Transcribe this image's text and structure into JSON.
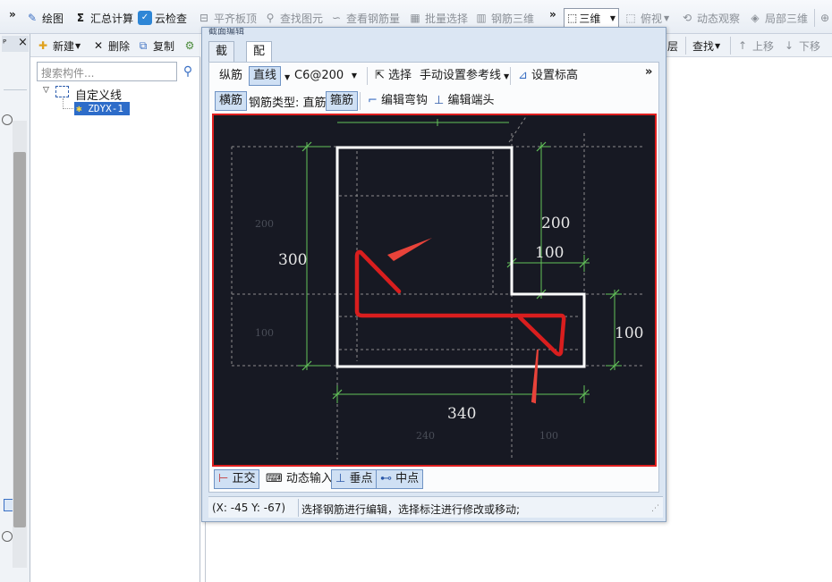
{
  "toolbar": {
    "overflow": "»",
    "draw": "绘图",
    "calc": "汇总计算",
    "cloud_check": "云检查",
    "align_slab": "平齐板顶",
    "find_element": "查找图元",
    "view_rebar": "查看钢筋量",
    "batch_select": "批量选择",
    "rebar_3d": "钢筋三维",
    "overflow2": "»",
    "view_3d": "三维",
    "top_view": "俯视",
    "dynamic_view": "动态观察",
    "local_3d": "局部三维"
  },
  "left_strip": {
    "pin": "ᴾ",
    "close": "×"
  },
  "component_panel": {
    "new": "新建",
    "delete": "删除",
    "copy": "复制",
    "search_placeholder": "搜索构件...",
    "tree_root": "自定义线",
    "tree_child": "ZDYX-1"
  },
  "right_toolbar": {
    "layer": "层",
    "find": "查找",
    "move_up": "上移",
    "move_down": "下移"
  },
  "dialog": {
    "title": "截面编辑",
    "tabs": [
      "截面",
      "配筋"
    ],
    "active_tab": "配筋",
    "row1": {
      "longitudinal": "纵筋",
      "mode": "直线",
      "spec": "C6@200",
      "select": "选择",
      "manual_ref": "手动设置参考线",
      "set_elevation": "设置标高",
      "overflow": "»"
    },
    "row2": {
      "transverse": "横筋",
      "type_label": "钢筋类型:",
      "type_value": "直筋",
      "stirrup": "箍筋",
      "edit_hook": "编辑弯钩",
      "edit_end": "编辑端头"
    },
    "snap": {
      "ortho": "正交",
      "dynamic_input": "动态输入",
      "perpendicular": "垂点",
      "midpoint": "中点"
    },
    "status": {
      "coord": "(X: -45 Y: -67)",
      "message": "选择钢筋进行编辑，选择标注进行修改或移动;"
    }
  },
  "drawing": {
    "dims": {
      "height_total": "300",
      "upper_right": "200",
      "step_width": "100",
      "step_height": "100",
      "bottom_width": "340",
      "faint_left_top": "200",
      "faint_left_bottom": "100",
      "faint_bottom_left": "240",
      "faint_bottom_right": "100"
    },
    "colors": {
      "background": "#171923",
      "section_outline": "#ffffff",
      "rebar": "#d91e1e",
      "dimension": "#63c25a",
      "arrow": "#e8433a",
      "guide": "#8c8c8c"
    }
  }
}
